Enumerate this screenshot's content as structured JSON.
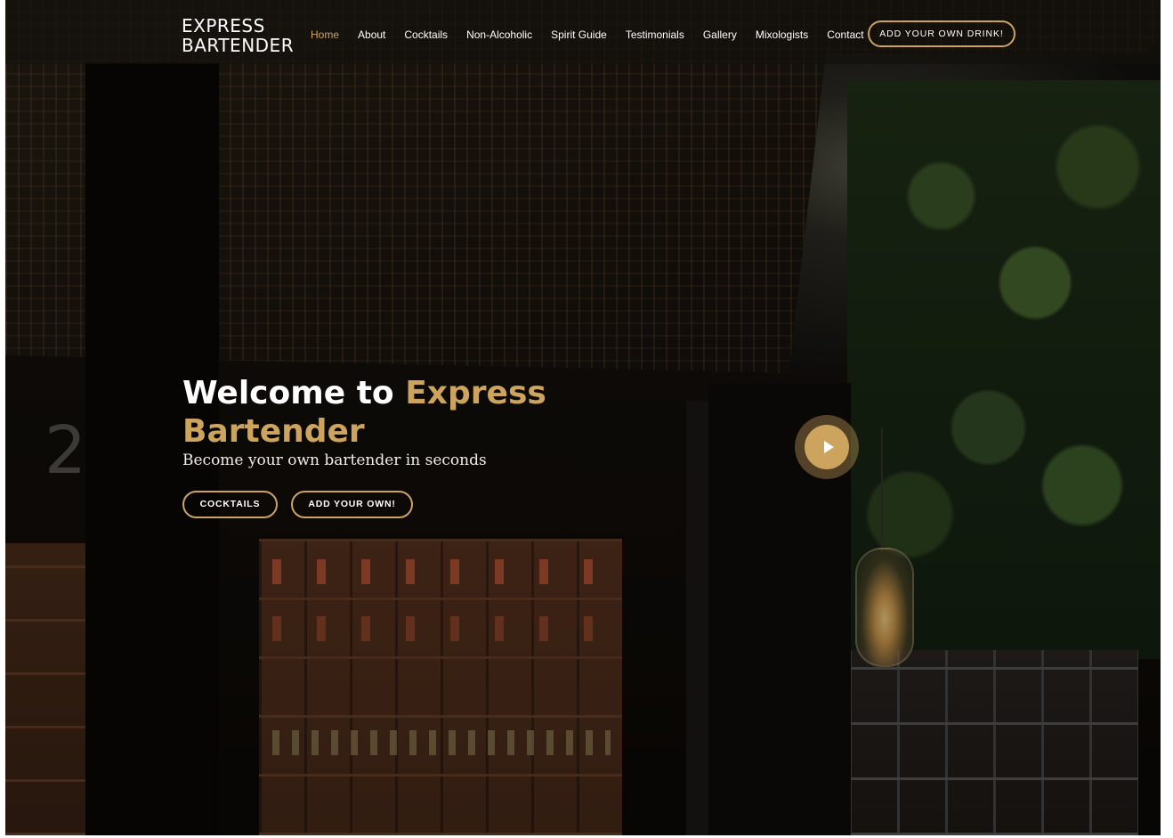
{
  "brand": {
    "line1": "EXPRESS",
    "line2": "BARTENDER"
  },
  "nav": {
    "items": [
      {
        "label": "Home",
        "active": true
      },
      {
        "label": "About"
      },
      {
        "label": "Cocktails"
      },
      {
        "label": "Non-Alcoholic"
      },
      {
        "label": "Spirit Guide"
      },
      {
        "label": "Testimonials"
      },
      {
        "label": "Gallery"
      },
      {
        "label": "Mixologists"
      },
      {
        "label": "Contact"
      }
    ],
    "cta_label": "ADD YOUR OWN DRINK!"
  },
  "hero": {
    "title_prefix": "Welcome to ",
    "title_accent": "Express Bartender",
    "subtitle": "Become your own bartender in seconds",
    "buttons": {
      "cocktails": "COCKTAILS",
      "add_own": "ADD YOUR OWN!"
    },
    "play_icon": "play-icon"
  },
  "colors": {
    "accent": "#cda45e",
    "text": "#ffffff",
    "header_bg": "#14100c"
  }
}
